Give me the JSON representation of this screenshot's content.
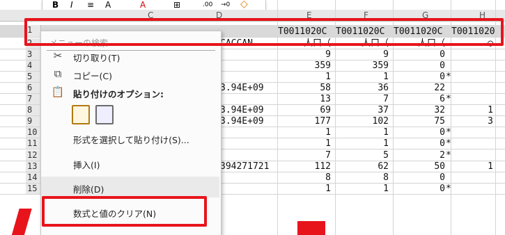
{
  "ribbon": {
    "buttons": [
      "B",
      "I",
      "≡",
      "A",
      "▾",
      "⊞",
      ".00",
      "→0",
      "◇"
    ]
  },
  "columns": [
    "C",
    "D",
    "E",
    "F",
    "G",
    "H"
  ],
  "row1": {
    "num": "1",
    "E": "T0011020C",
    "F": "T0011020C",
    "G": "T0011020C",
    "H": "T0011020"
  },
  "rows": [
    {
      "num": "2",
      "D": "CACCAN",
      "E": "人口（",
      "F": "人口（",
      "G": "人口（",
      "H": "◯"
    },
    {
      "num": "3",
      "D": "",
      "E": "9",
      "F": "9",
      "G": "0",
      "flag": ""
    },
    {
      "num": "4",
      "D": "",
      "E": "359",
      "F": "359",
      "G": "0",
      "flag": ""
    },
    {
      "num": "5",
      "D": "",
      "E": "1",
      "F": "1",
      "G": "0",
      "flag": "*"
    },
    {
      "num": "6",
      "D": "3.94E+09",
      "E": "58",
      "F": "36",
      "G": "22",
      "flag": ""
    },
    {
      "num": "7",
      "D": "",
      "E": "13",
      "F": "7",
      "G": "6",
      "flag": "*"
    },
    {
      "num": "8",
      "D": "3.94E+09",
      "E": "69",
      "F": "37",
      "G": "32",
      "flag": "",
      "H": "1"
    },
    {
      "num": "9",
      "D": "3.94E+09",
      "E": "177",
      "F": "102",
      "G": "75",
      "flag": "",
      "H": "3"
    },
    {
      "num": "10",
      "D": "",
      "E": "1",
      "F": "1",
      "G": "0",
      "flag": "*"
    },
    {
      "num": "11",
      "D": "",
      "E": "1",
      "F": "1",
      "G": "0",
      "flag": "*"
    },
    {
      "num": "12",
      "D": "",
      "E": "7",
      "F": "5",
      "G": "2",
      "flag": "*"
    },
    {
      "num": "13",
      "D": "394271721",
      "E": "112",
      "F": "62",
      "G": "50",
      "flag": "",
      "H": "1"
    },
    {
      "num": "14",
      "D": "",
      "E": "8",
      "F": "8",
      "G": "0",
      "flag": ""
    },
    {
      "num": "15",
      "D": "",
      "E": "1",
      "F": "1",
      "G": "0",
      "flag": "*"
    }
  ],
  "context_menu": {
    "search_placeholder": "メニューの検索",
    "items": [
      {
        "label": "切り取り(T)",
        "icon": "scissors-icon"
      },
      {
        "label": "コピー(C)",
        "icon": "copy-icon"
      },
      {
        "label": "貼り付けのオプション:",
        "icon": "paste-icon"
      },
      {
        "label": "形式を選択して貼り付け(S)...",
        "icon": ""
      },
      {
        "label": "挿入(I)",
        "icon": ""
      },
      {
        "label": "削除(D)",
        "icon": ""
      },
      {
        "label": "数式と値のクリア(N)",
        "icon": ""
      }
    ]
  },
  "colors": {
    "highlight_red": "#e8141c",
    "header_gray": "#e8e8e8",
    "grid_line": "#d4d4d4"
  }
}
